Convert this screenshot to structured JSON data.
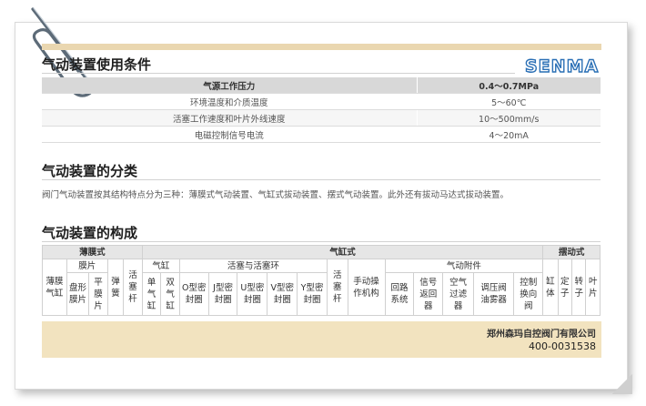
{
  "brand": {
    "logo_text": "SENMA",
    "logo_color": "#2a6fb5"
  },
  "section_titles": {
    "conditions": "气动装置使用条件",
    "classification": "气动装置的分类",
    "composition": "气动装置的构成"
  },
  "conditions_table": {
    "header": {
      "label": "气源工作压力",
      "value": "0.4～0.7MPa"
    },
    "rows": [
      {
        "label": "环境温度和介质温度",
        "value": "5～60℃"
      },
      {
        "label": "活塞工作速度和叶片外线速度",
        "value": "10～500mm/s"
      },
      {
        "label": "电磁控制信号电流",
        "value": "4～20mA"
      }
    ]
  },
  "classification_text": "阀门气动装置按其结构特点分为三种：薄膜式气动装置、气缸式拔动装置、摆式气动装置。此外还有拔动马达式拔动装置。",
  "composition_table": {
    "groups": {
      "diaphragm": "薄膜式",
      "cylinder": "气缸式",
      "swing": "摆动式"
    },
    "sub": {
      "membrane": "膜片",
      "cylinder": "气缸",
      "piston_ring": "活塞与活塞环",
      "accessories": "气动附件"
    },
    "cells": {
      "diaphragm_cylinder": "薄膜气缸",
      "disc_membrane": "盘形膜片",
      "flat_membrane": "平膜片",
      "spring": "弹簧",
      "piston_rod_1": "活塞杆",
      "single_cylinder": "单气缸",
      "double_cylinder": "双气缸",
      "o_seal": "O型密封圈",
      "j_seal": "J型密封圈",
      "u_seal": "U型密封圈",
      "v_seal": "V型密封圈",
      "y_seal": "Y型密封圈",
      "piston_rod_2": "活塞杆",
      "manual": "手动操作机构",
      "loop_system": "回路系统",
      "signal_return": "信号返回器",
      "air_filter": "空气过滤器",
      "pressure_oil": "调压阀油雾器",
      "control_valve": "控制换向阀",
      "cylinder_body": "缸体",
      "stator": "定子",
      "rotor": "转子",
      "blade": "叶片"
    }
  },
  "footer": {
    "company": "郑州森玛自控阀门有限公司",
    "phone": "400-0031538"
  },
  "colors": {
    "tan": "#ead7b0",
    "footer": "#f2e3bf",
    "header_grey": "#d8d8d8"
  }
}
